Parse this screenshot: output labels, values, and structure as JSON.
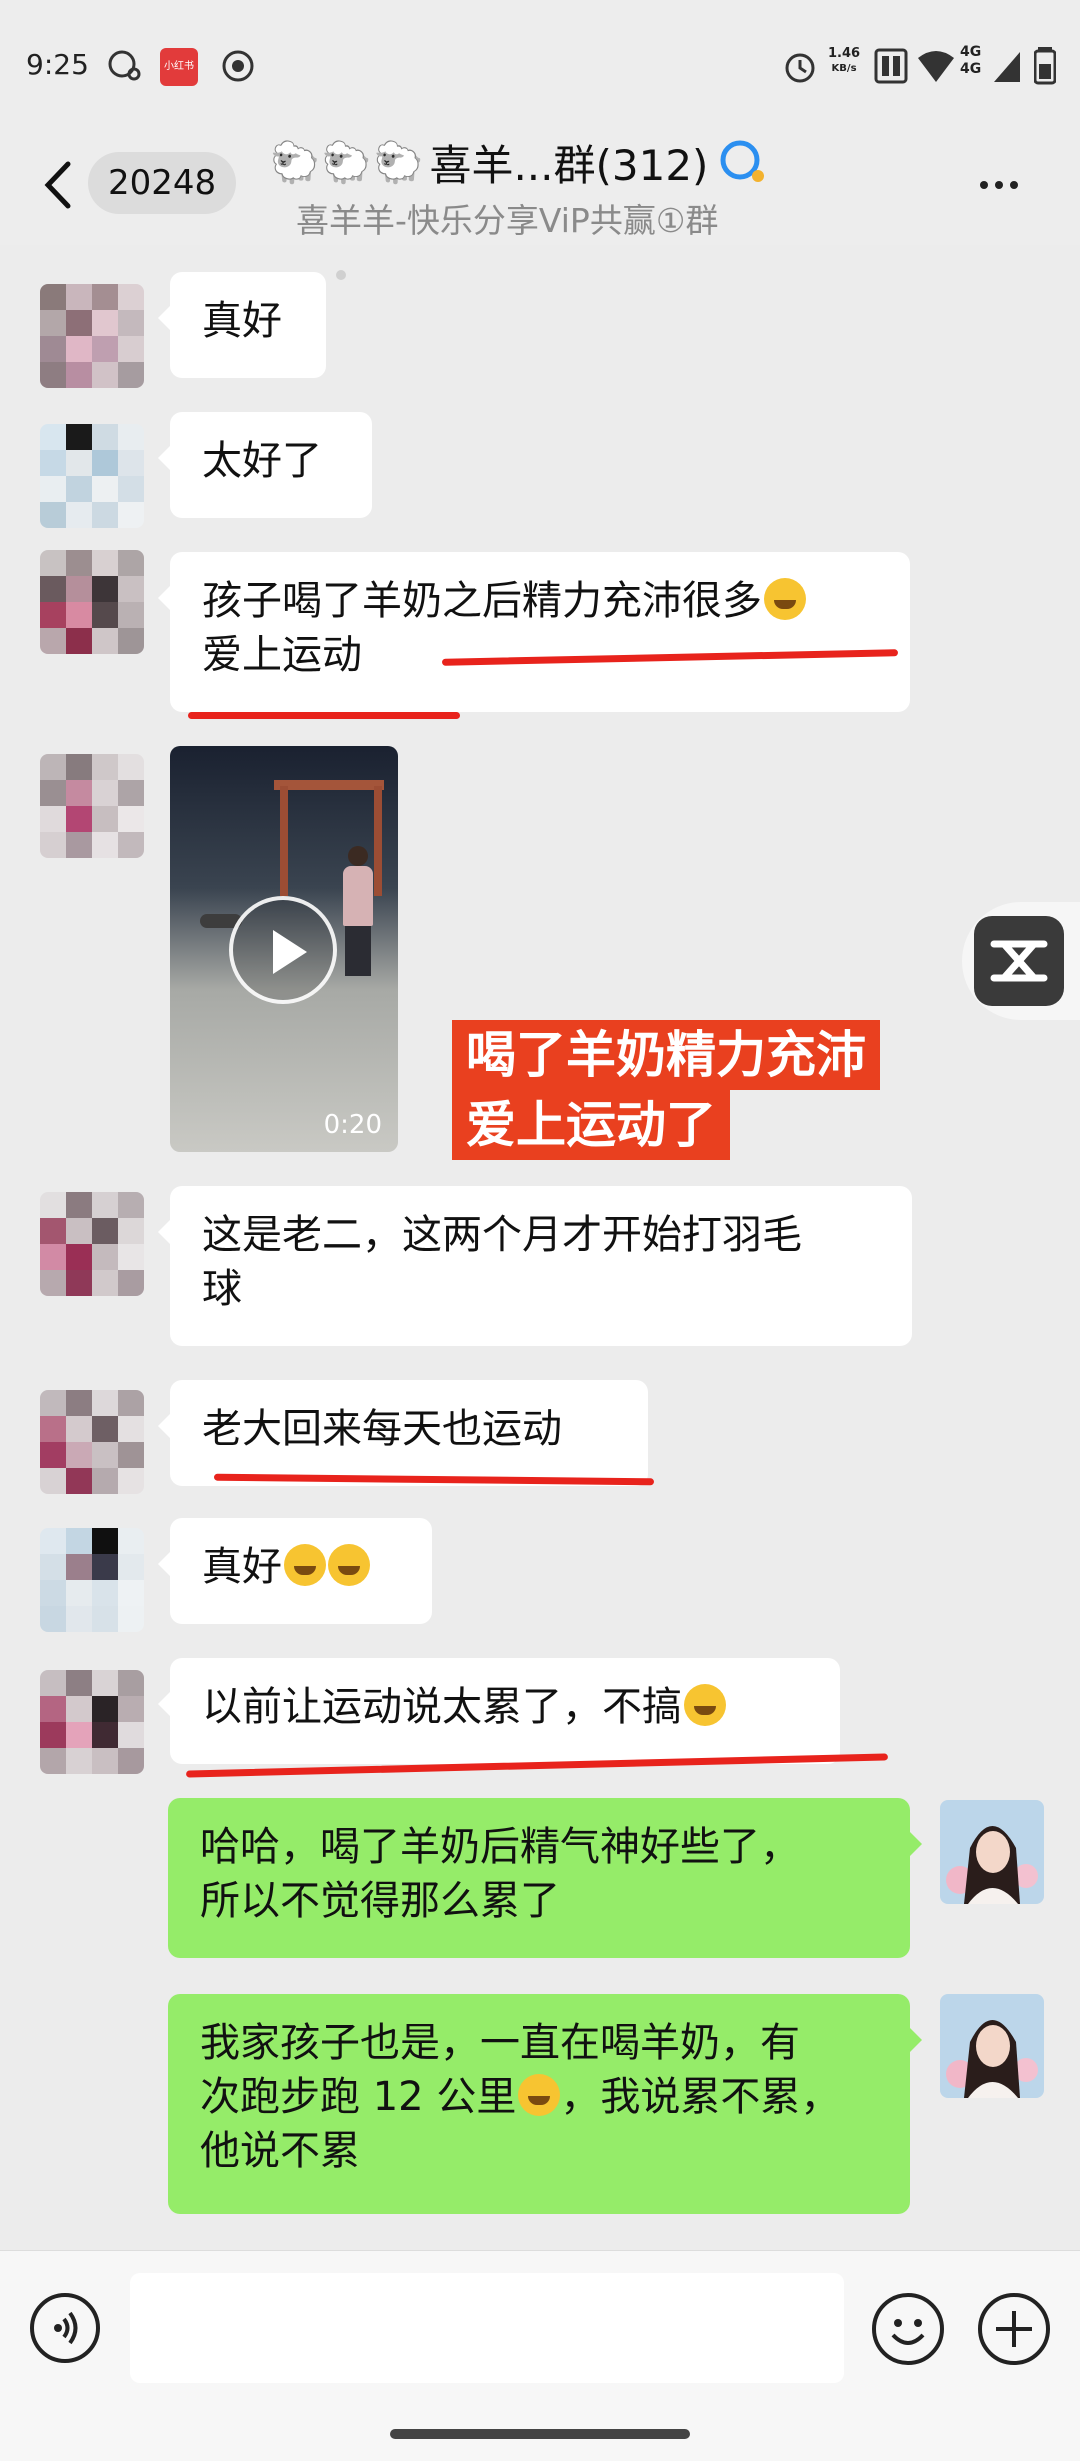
{
  "status_bar": {
    "time": "9:25",
    "app_badge": "小红书",
    "net_speed_value": "1.46",
    "net_speed_unit": "KB/s",
    "network_type_1": "4G",
    "network_type_2": "4G"
  },
  "header": {
    "unread_count": "20248",
    "title": "喜羊...群(312)",
    "subtitle": "喜羊羊-快乐分享ViP共赢①群"
  },
  "messages": [
    {
      "side": "left",
      "text": "真好"
    },
    {
      "side": "left",
      "text": "太好了"
    },
    {
      "side": "left",
      "line1": "孩子喝了羊奶之后精力充沛很多",
      "line2": "爱上运动"
    },
    {
      "side": "left",
      "type": "video",
      "duration": "0:20"
    },
    {
      "side": "left",
      "line1": "这是老二，这两个月才开始打羽毛",
      "line2": "球"
    },
    {
      "side": "left",
      "text": "老大回来每天也运动"
    },
    {
      "side": "left",
      "text": "真好"
    },
    {
      "side": "left",
      "text": "以前让运动说太累了，不搞"
    },
    {
      "side": "right",
      "line1": "哈哈，喝了羊奶后精气神好些了，",
      "line2": "所以不觉得那么累了"
    },
    {
      "side": "right",
      "line1": "我家孩子也是，一直在喝羊奶，有",
      "line2a": "次跑步跑 12 公里",
      "line2b": "，我说累不累，",
      "line3": "他说不累"
    }
  ],
  "caption": {
    "line1": "喝了羊奶精力充沛",
    "line2": "爱上运动了"
  },
  "colors": {
    "self_bubble": "#95ec69",
    "other_bubble": "#ffffff",
    "highlight_red": "#e8231c",
    "background": "#ededed"
  }
}
